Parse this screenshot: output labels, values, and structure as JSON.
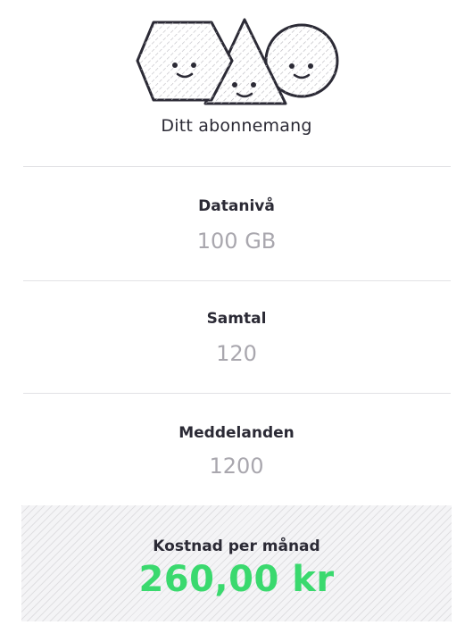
{
  "header": {
    "logo_icon": "three-faces-logo-icon",
    "title": "Ditt abonnemang"
  },
  "details": [
    {
      "label": "Datanivå",
      "value": "100 GB"
    },
    {
      "label": "Samtal",
      "value": "120"
    },
    {
      "label": "Meddelanden",
      "value": "1200"
    }
  ],
  "cost": {
    "label": "Kostnad per månad",
    "value": "260,00 kr"
  },
  "colors": {
    "text": "#2b2a35",
    "muted": "#a9a7ae",
    "accent_green": "#3ad96e",
    "divider": "#e2e2e5"
  }
}
